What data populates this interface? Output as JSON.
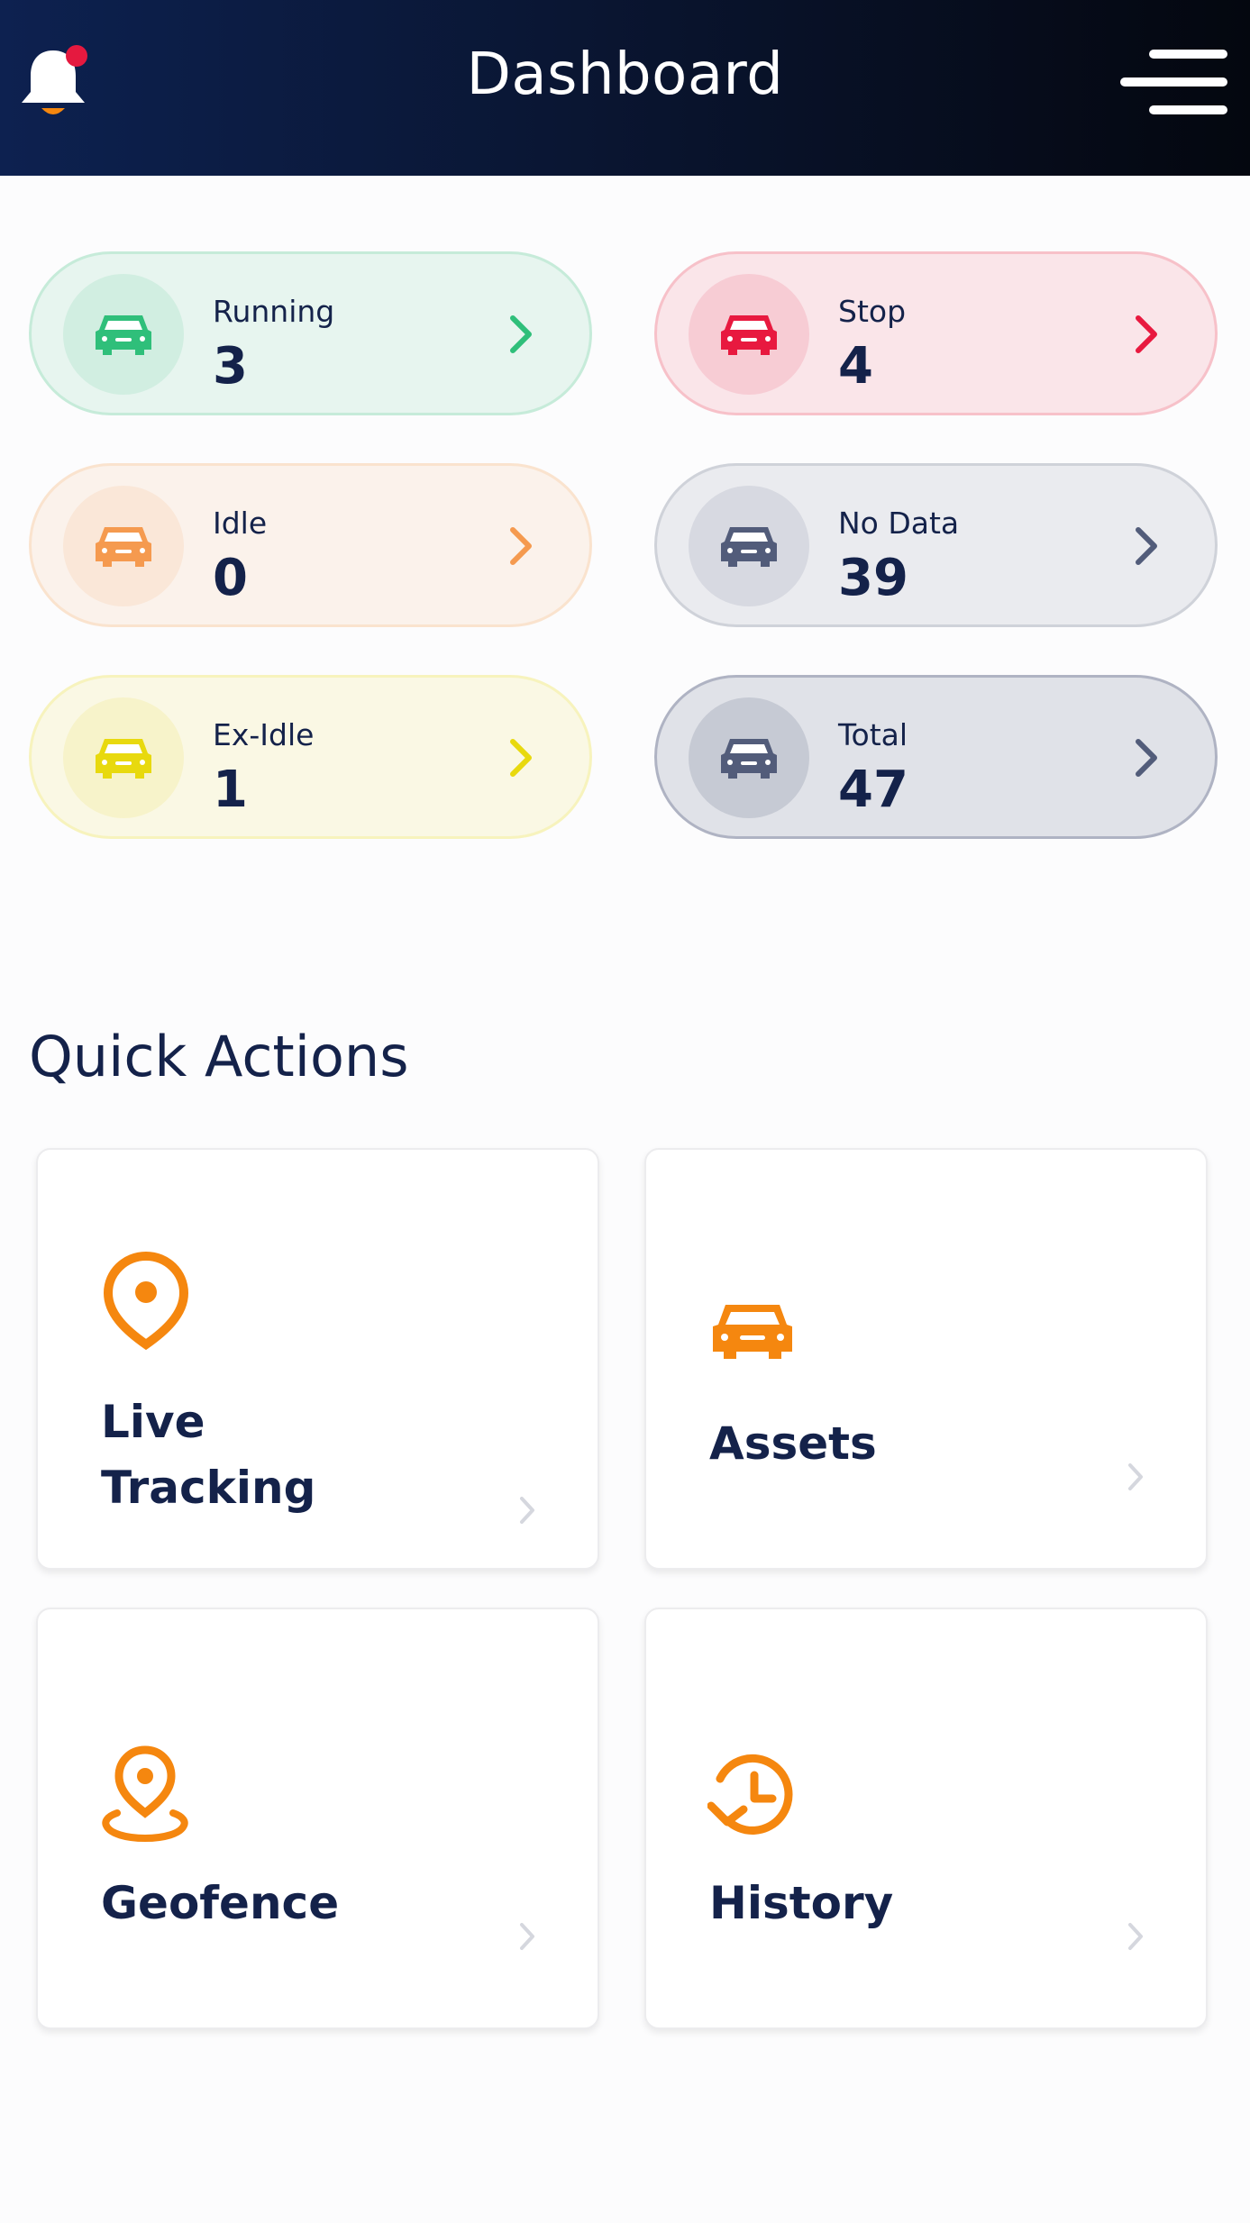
{
  "header": {
    "title": "Dashboard",
    "bell_icon": "bell-icon",
    "menu_icon": "hamburger-menu-icon",
    "notification_dot_color": "#e5193f"
  },
  "status_cards": [
    {
      "key": "running",
      "label": "Running",
      "value": "3",
      "accent": "#2fbf7a",
      "icon": "car-icon"
    },
    {
      "key": "stop",
      "label": "Stop",
      "value": "4",
      "accent": "#e8193f",
      "icon": "car-icon"
    },
    {
      "key": "idle",
      "label": "Idle",
      "value": "0",
      "accent": "#f59a4f",
      "icon": "car-icon"
    },
    {
      "key": "no-data",
      "label": "No Data",
      "value": "39",
      "accent": "#525c7a",
      "icon": "car-icon"
    },
    {
      "key": "ex-idle",
      "label": "Ex-Idle",
      "value": "1",
      "accent": "#e8d90e",
      "icon": "car-icon"
    },
    {
      "key": "total",
      "label": "Total",
      "value": "47",
      "accent": "#525c7a",
      "icon": "car-icon"
    }
  ],
  "quick_actions": {
    "title": "Quick Actions",
    "accent": "#f5870f",
    "items": [
      {
        "key": "live-tracking",
        "line1": "Live",
        "line2": "Tracking",
        "icon": "location-pin-icon"
      },
      {
        "key": "assets",
        "label": "Assets",
        "icon": "car-icon"
      },
      {
        "key": "geofence",
        "label": "Geofence",
        "icon": "geofence-icon"
      },
      {
        "key": "history",
        "label": "History",
        "icon": "history-icon"
      }
    ]
  }
}
